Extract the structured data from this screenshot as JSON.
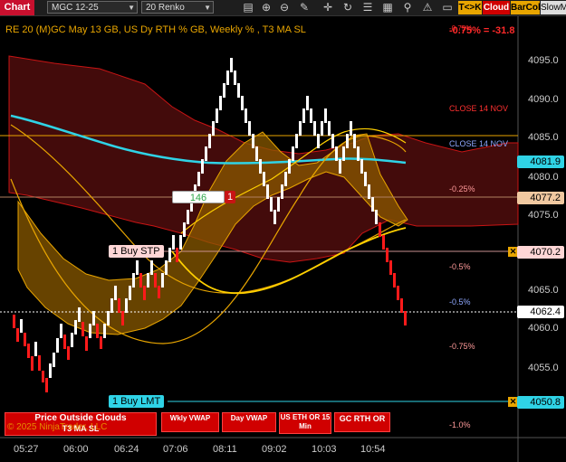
{
  "toolbar": {
    "chart_label": "Chart",
    "instrument": "MGC 12-25",
    "bar_type": "20 Renko",
    "buttons": {
      "t_k": "T<>K",
      "cloud": "Cloud",
      "barcol": "BarCol",
      "slowm": "SlowM"
    },
    "icons": [
      "crosshair-icon",
      "zoom-in-icon",
      "zoom-out-icon",
      "eraser-icon",
      "draw-plus-icon",
      "sync-icon",
      "properties-icon",
      "order-icon",
      "strategy-icon",
      "alert-icon",
      "window-icon"
    ]
  },
  "chart": {
    "series_title": "RE 20  (M)GC May 13 GB, US Dy RTH % GB, Weekly % , T3 MA SL",
    "net_change_top": "-0.75%",
    "net_change": "-0.75% = -31.8",
    "y_axis": [
      "4095.0",
      "4090.0",
      "4085.0",
      "4080.0",
      "4075.0",
      "4070.0",
      "4065.0",
      "4060.0",
      "4055.0",
      "4050.0"
    ],
    "price_boxes": {
      "last_ma": "4081.9",
      "level_077": "4077.2",
      "stop": "4070.2",
      "last": "4062.4",
      "limit": "4050.8"
    },
    "x_axis": [
      "05:27",
      "06:00",
      "06:24",
      "07:06",
      "08:11",
      "09:02",
      "10:03",
      "10:54"
    ],
    "annotations": {
      "close_red": "CLOSE 14 NOV",
      "close_blue": "CLOSE 14 NOV",
      "pct_025": "-0.25%",
      "pct_05a": "-0.5%",
      "pct_05b": "-0.5%",
      "pct_075": "-0.75%",
      "pct_10": "-1.0%"
    },
    "position": {
      "qty": "146",
      "side": "1"
    },
    "orders": {
      "stop": "1 Buy STP",
      "limit": "1 Buy LMT"
    },
    "copyright": "© 2025 NinjaTrader, LLC"
  },
  "bottom_buttons": {
    "price_outside": "Price Outside Clouds",
    "t3_ma_sl": "T3 MA SL",
    "wkly_vwap": "Wkly VWAP",
    "day_vwap": "Day VWAP",
    "us_eth": "US ETH OR 15 Min",
    "gc_rth": "GC RTH OR"
  },
  "colors": {
    "up_brick": "#ffffff",
    "down_brick": "#ff1a1a",
    "cyan_ma": "#2fd3e6",
    "gold": "#e8a500",
    "cloud_red": "#5a0f0f",
    "cloud_gold": "#8a5a00"
  }
}
